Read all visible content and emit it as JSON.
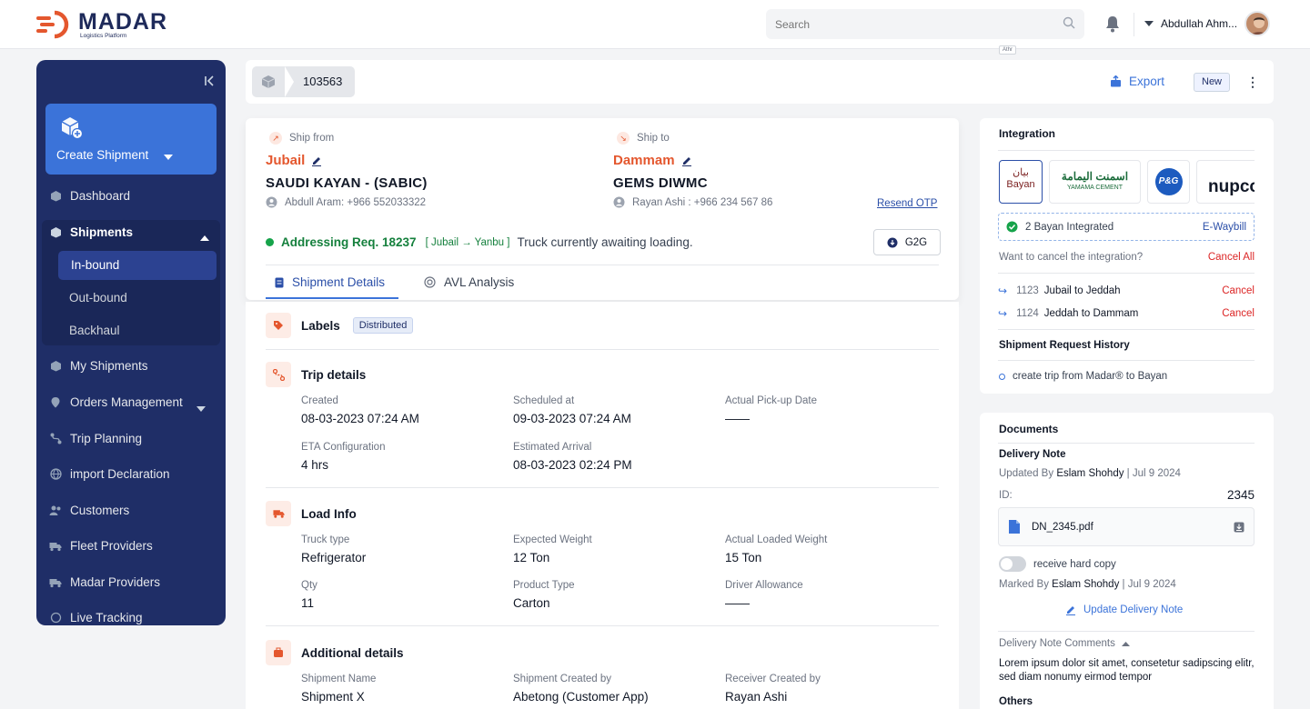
{
  "app": {
    "name": "MADAR",
    "subtitle": "Logistics Platform"
  },
  "header": {
    "search_placeholder": "Search",
    "user_name": "Abdullah Ahm..."
  },
  "sidebar": {
    "create_label": "Create Shipment",
    "items": [
      {
        "label": "Dashboard"
      },
      {
        "label": "Shipments"
      },
      {
        "label": "In-bound"
      },
      {
        "label": "Out-bound"
      },
      {
        "label": "Backhaul"
      },
      {
        "label": "My Shipments"
      },
      {
        "label": "Orders Management"
      },
      {
        "label": "Trip Planning"
      },
      {
        "label": "import Declaration"
      },
      {
        "label": "Customers"
      },
      {
        "label": "Fleet Providers"
      },
      {
        "label": "Madar Providers"
      },
      {
        "label": "Live Tracking"
      }
    ]
  },
  "page": {
    "shipment_id": "103563",
    "athr_tag": "Athr",
    "export_label": "Export",
    "status_badge": "New"
  },
  "shipment": {
    "from": {
      "label": "Ship from",
      "city": "Jubail",
      "company": "SAUDI KAYAN - (SABIC)",
      "contact": "Abdull Aram: +966 552033322"
    },
    "to": {
      "label": "Ship to",
      "city": "Dammam",
      "company": "GEMS DIWMC",
      "contact": "Rayan Ashi : +966 234 567 86"
    },
    "resend_label": "Resend OTP",
    "addressing": "Addressing Req. 18237",
    "route": "[ Jubail → Yanbu ]",
    "status": "Truck currently awaiting loading.",
    "g2g_label": "G2G",
    "tabs": [
      {
        "label": "Shipment Details"
      },
      {
        "label": "AVL Analysis"
      }
    ]
  },
  "details": {
    "labels": {
      "title": "Labels",
      "tag": "Distributed"
    },
    "trip": {
      "title": "Trip details",
      "fields": [
        {
          "label": "Created",
          "value": "08-03-2023 07:24 AM"
        },
        {
          "label": "Scheduled at",
          "value": "09-03-2023 07:24 AM"
        },
        {
          "label": "Actual Pick-up Date",
          "value": "——"
        },
        {
          "label": "ETA Configuration",
          "value": "4 hrs"
        },
        {
          "label": "Estimated Arrival",
          "value": "08-03-2023 02:24 PM"
        }
      ]
    },
    "load": {
      "title": "Load Info",
      "fields": [
        {
          "label": "Truck type",
          "value": "Refrigerator"
        },
        {
          "label": "Expected Weight",
          "value": "12 Ton"
        },
        {
          "label": "Actual Loaded Weight",
          "value": "15 Ton"
        },
        {
          "label": "Qty",
          "value": "11"
        },
        {
          "label": "Product Type",
          "value": "Carton"
        },
        {
          "label": "Driver Allowance",
          "value": "——"
        }
      ]
    },
    "additional": {
      "title": "Additional details",
      "fields": [
        {
          "label": "Shipment Name",
          "value": "Shipment X"
        },
        {
          "label": "Shipment Created by",
          "value": "Abetong (Customer App)"
        },
        {
          "label": "Receiver Created by",
          "value": "Rayan Ashi"
        }
      ]
    }
  },
  "integration": {
    "title": "Integration",
    "logos": [
      {
        "line1": "بيان",
        "line2": "Bayan"
      },
      {
        "line1": "اسمنت اليمامة",
        "line2": "YAMAMA CEMENT"
      },
      {
        "line1": "P&G"
      },
      {
        "line1": "nupco"
      }
    ],
    "integrated_text": "2 Bayan Integrated",
    "ewaybill": "E-Waybill",
    "cancel_question": "Want to cancel the integration?",
    "cancel_all": "Cancel All",
    "routes": [
      {
        "id": "1123",
        "name": "Jubail to Jeddah",
        "action": "Cancel"
      },
      {
        "id": "1124",
        "name": "Jeddah to Dammam",
        "action": "Cancel"
      }
    ],
    "history_title": "Shipment Request History",
    "history_item": "create trip from Madar® to Bayan"
  },
  "documents": {
    "title": "Documents",
    "note_title": "Delivery Note",
    "updated_prefix": "Updated By",
    "updated_by": "Eslam Shohdy",
    "updated_date": "| Jul 9 2024",
    "id_label": "ID:",
    "id_value": "2345",
    "file_name": "DN_2345.pdf",
    "hardcopy_label": "receive hard copy",
    "marked_prefix": "Marked By",
    "marked_by": "Eslam Shohdy",
    "marked_date": "| Jul 9 2024",
    "update_label": "Update Delivery Note",
    "comments_title": "Delivery Note Comments",
    "comment": "Lorem ipsum dolor sit amet, consetetur sadipscing elitr, sed diam nonumy eirmod tempor",
    "others_title": "Others"
  },
  "colors": {
    "brand_navy": "#1f2e67",
    "accent_blue": "#3b73d9",
    "accent_orange": "#e4572e",
    "success_green": "#16a34a",
    "danger_red": "#dc2626"
  }
}
